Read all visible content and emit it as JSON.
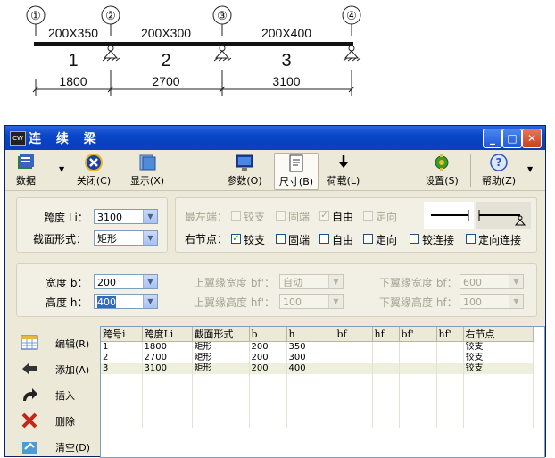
{
  "diagram": {
    "nodes": [
      "①",
      "②",
      "③",
      "④"
    ],
    "sections": [
      "200X350",
      "200X300",
      "200X400"
    ],
    "span_numbers": [
      "1",
      "2",
      "3"
    ],
    "dimensions": [
      "1800",
      "2700",
      "3100"
    ]
  },
  "window": {
    "title": "连 续 梁",
    "icon_text": "CW",
    "buttons": {
      "minimize": "_",
      "maximize": "□",
      "close": "✕"
    }
  },
  "toolbar": {
    "data": "数据",
    "close": "关闭(C)",
    "display": "显示(X)",
    "params": "参数(O)",
    "size": "尺寸(B)",
    "load": "荷载(L)",
    "settings": "设置(S)",
    "help": "帮助(Z)"
  },
  "span_group": {
    "span_label": "跨度 Li：",
    "span_value": "3100",
    "section_label": "截面形式：",
    "section_value": "矩形"
  },
  "support_group": {
    "left_end_label": "最左端：",
    "right_node_label": "右节点：",
    "left_options": [
      {
        "label": "铰支",
        "checked": false
      },
      {
        "label": "固端",
        "checked": false
      },
      {
        "label": "自由",
        "checked": true
      },
      {
        "label": "定向",
        "checked": false
      }
    ],
    "right_options": [
      {
        "label": "铰支",
        "checked": true
      },
      {
        "label": "固端",
        "checked": false
      },
      {
        "label": "自由",
        "checked": false
      },
      {
        "label": "定向",
        "checked": false
      }
    ],
    "extra_options": [
      {
        "label": "铰连接",
        "checked": false
      },
      {
        "label": "定向连接",
        "checked": false
      }
    ]
  },
  "dims_group": {
    "width_label": "宽度 b：",
    "width_value": "200",
    "height_label": "高度 h：",
    "height_value": "400",
    "upper_width_label": "上翼缘宽度 bf'：",
    "upper_width_value": "自动",
    "upper_height_label": "上翼缘高度 hf'：",
    "upper_height_value": "100",
    "lower_width_label": "下翼缘宽度 bf：",
    "lower_width_value": "600",
    "lower_height_label": "下翼缘高度 hf：",
    "lower_height_value": "100"
  },
  "side_actions": {
    "edit": "编辑(R)",
    "add": "添加(A)",
    "insert": "插入",
    "delete": "删除",
    "clear": "清空(D)"
  },
  "table": {
    "columns": [
      "跨号i",
      "跨度Li",
      "截面形式",
      "b",
      "h",
      "bf",
      "hf",
      "bf'",
      "hf'",
      "右节点"
    ],
    "rows": [
      [
        "1",
        "1800",
        "矩形",
        "200",
        "350",
        "",
        "",
        "",
        "",
        "铰支"
      ],
      [
        "2",
        "2700",
        "矩形",
        "200",
        "300",
        "",
        "",
        "",
        "",
        "铰支"
      ],
      [
        "3",
        "3100",
        "矩形",
        "200",
        "400",
        "",
        "",
        "",
        "",
        "铰支"
      ]
    ]
  }
}
